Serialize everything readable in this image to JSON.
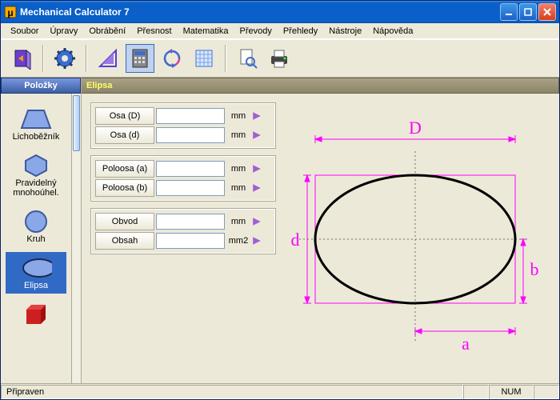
{
  "titlebar": {
    "title": "Mechanical Calculator 7"
  },
  "menu": {
    "items": [
      "Soubor",
      "Úpravy",
      "Obrábění",
      "Přesnost",
      "Matematika",
      "Převody",
      "Přehledy",
      "Nástroje",
      "Nápověda"
    ]
  },
  "sidebar": {
    "header": "Položky",
    "items": [
      {
        "label": "Lichoběžník"
      },
      {
        "label": "Pravidelný mnohoúhel."
      },
      {
        "label": "Kruh"
      },
      {
        "label": "Elipsa"
      },
      {
        "label": ""
      }
    ]
  },
  "main": {
    "header": "Elipsa",
    "groups": [
      {
        "rows": [
          {
            "label": "Osa (D)",
            "value": "",
            "unit": "mm"
          },
          {
            "label": "Osa (d)",
            "value": "",
            "unit": "mm"
          }
        ]
      },
      {
        "rows": [
          {
            "label": "Poloosa (a)",
            "value": "",
            "unit": "mm"
          },
          {
            "label": "Poloosa (b)",
            "value": "",
            "unit": "mm"
          }
        ]
      },
      {
        "rows": [
          {
            "label": "Obvod",
            "value": "",
            "unit": "mm"
          },
          {
            "label": "Obsah",
            "value": "",
            "unit": "mm2"
          }
        ]
      }
    ],
    "diagram": {
      "D": "D",
      "d": "d",
      "a": "a",
      "b": "b"
    }
  },
  "status": {
    "ready": "Připraven",
    "num": "NUM"
  }
}
